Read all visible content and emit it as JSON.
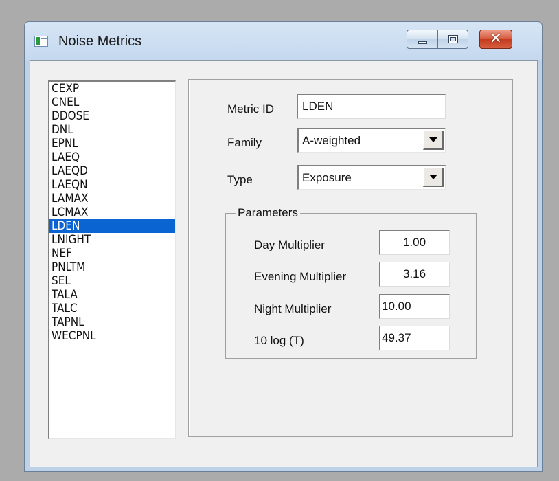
{
  "window": {
    "title": "Noise Metrics"
  },
  "metrics_list": {
    "items": [
      "CEXP",
      "CNEL",
      "DDOSE",
      "DNL",
      "EPNL",
      "LAEQ",
      "LAEQD",
      "LAEQN",
      "LAMAX",
      "LCMAX",
      "LDEN",
      "LNIGHT",
      "NEF",
      "PNLTM",
      "SEL",
      "TALA",
      "TALC",
      "TAPNL",
      "WECPNL"
    ],
    "selected": "LDEN"
  },
  "form": {
    "metric_id_label": "Metric ID",
    "metric_id_value": "LDEN",
    "family_label": "Family",
    "family_value": "A-weighted",
    "type_label": "Type",
    "type_value": "Exposure"
  },
  "parameters": {
    "title": "Parameters",
    "day_label": "Day Multiplier",
    "day_value": "1.00",
    "evening_label": "Evening Multiplier",
    "evening_value": "3.16",
    "night_label": "Night Multiplier",
    "night_value": "10.00",
    "tlog_label": "10 log (T)",
    "tlog_value": "49.37"
  }
}
